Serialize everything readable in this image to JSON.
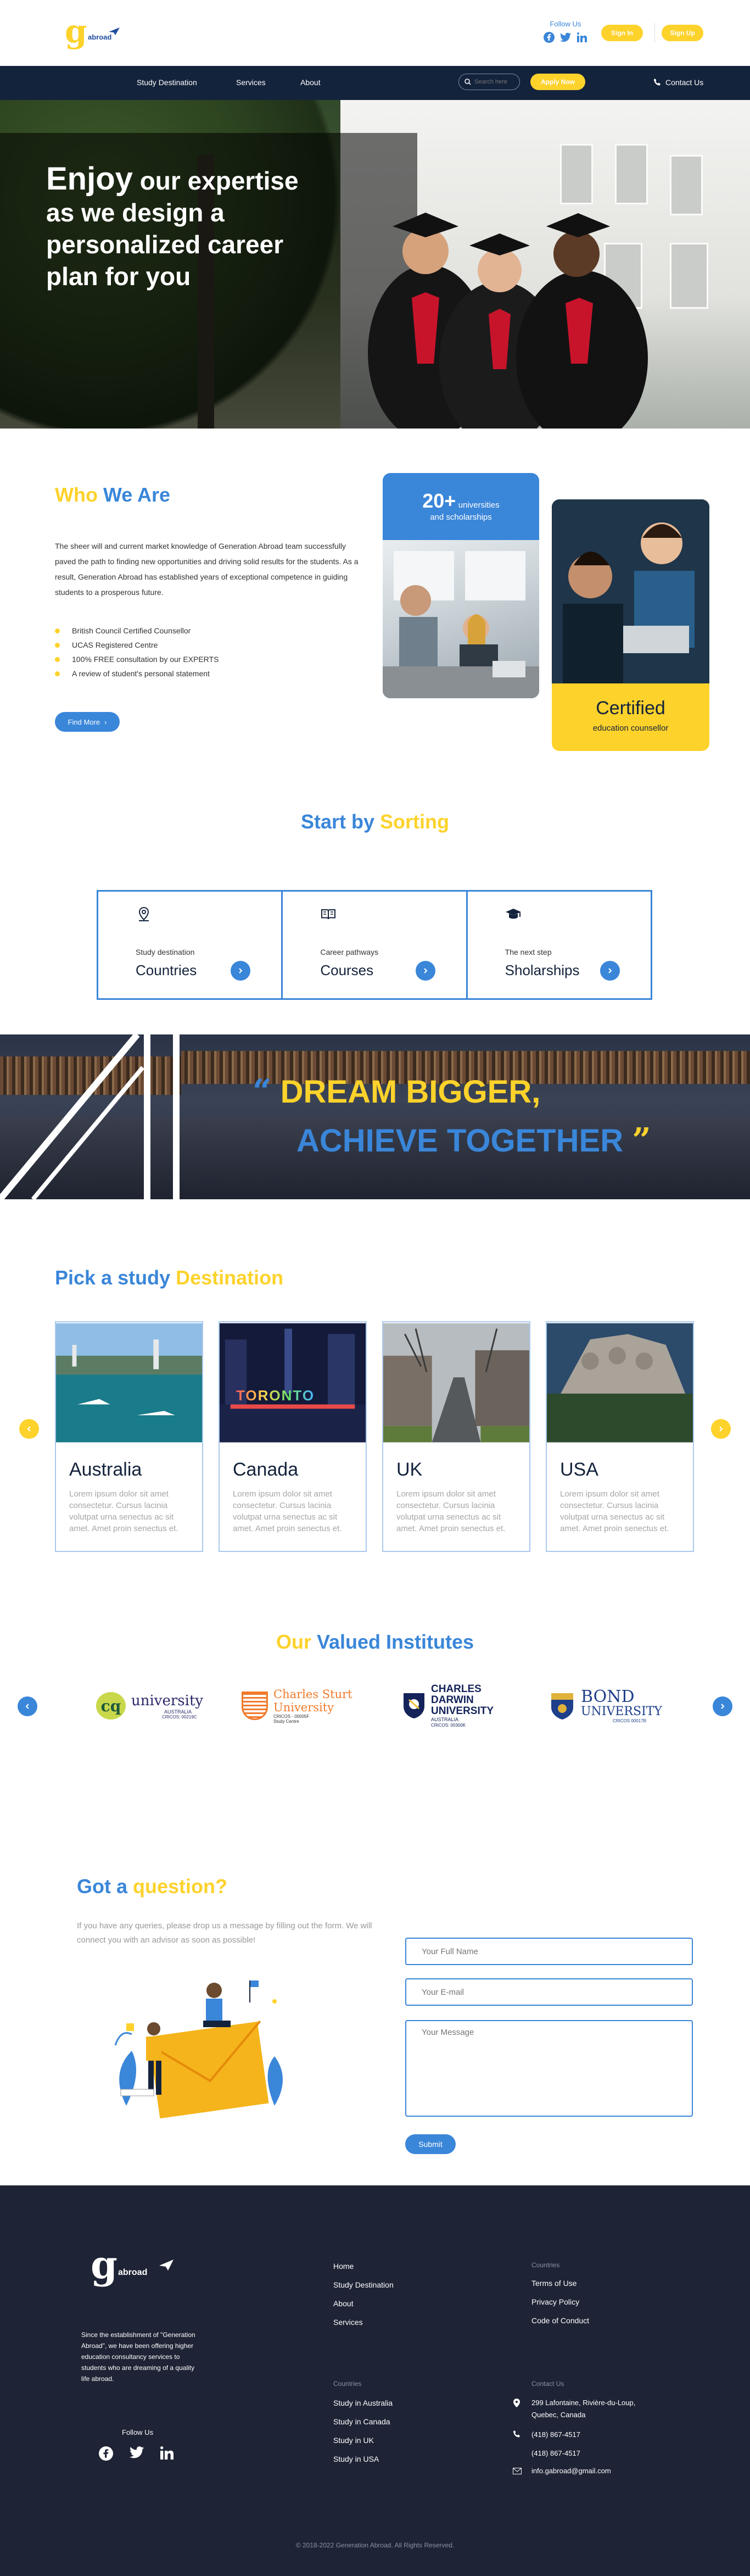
{
  "header": {
    "logo_letter": "g",
    "logo_text": "abroad",
    "follow_label": "Follow Us",
    "sign_in_label": "Sign In",
    "sign_up_label": "Sign Up"
  },
  "nav": {
    "items": [
      "Study Destination",
      "Services",
      "About"
    ],
    "search_placeholder": "Search here",
    "apply_label": "Apply Now",
    "contact_label": "Contact Us"
  },
  "hero": {
    "line1_big": "Enjoy",
    "line1_rest": " our expertise",
    "line2": "as we design a",
    "line3": "personalized career",
    "line4": "plan for you"
  },
  "who": {
    "title_a": "Who",
    "title_b": " We Are",
    "paragraph": "The sheer will and current market knowledge of Generation Abroad team successfully paved the path to finding new opportunities and driving solid results for the students. As a result, Generation Abroad has established years of exceptional competence in guiding students to a prosperous future.",
    "checks": [
      "British Council Certified Counsellor",
      "UCAS Registered Centre",
      "100% FREE consultation by our EXPERTS",
      "A review of student's personal statement"
    ],
    "button": "Find More",
    "stat_number": "20+",
    "stat_label_1": "universities",
    "stat_label_2": "and scholarships",
    "cert_title": "Certified",
    "cert_sub": "education counsellor"
  },
  "sorting": {
    "title_a": "Start by",
    "title_b": " Sorting",
    "items": [
      {
        "label": "Study destination",
        "value": "Countries",
        "icon": "map-pin-icon"
      },
      {
        "label": "Career pathways",
        "value": "Courses",
        "icon": "book-icon"
      },
      {
        "label": "The next step",
        "value": "Sholarships",
        "icon": "graduation-cap-icon"
      }
    ]
  },
  "dream": {
    "open_quote": "“",
    "line1": "DREAM BIGGER,",
    "line2": "ACHIEVE TOGETHER",
    "close_quote": "”"
  },
  "destination": {
    "title_a": "Pick a study",
    "title_b": " Destination",
    "cards": [
      {
        "name": "Australia",
        "desc": "Lorem ipsum dolor sit amet consectetur. Cursus lacinia volutpat urna senectus ac sit amet. Amet proin senectus et."
      },
      {
        "name": "Canada",
        "desc": "Lorem ipsum dolor sit amet consectetur. Cursus lacinia volutpat urna senectus ac sit amet. Amet proin senectus et."
      },
      {
        "name": "UK",
        "desc": "Lorem ipsum dolor sit amet consectetur. Cursus lacinia volutpat urna senectus ac sit amet. Amet proin senectus et."
      },
      {
        "name": "USA",
        "desc": "Lorem ipsum dolor sit amet consectetur. Cursus lacinia volutpat urna senectus ac sit amet. Amet proin senectus et."
      }
    ],
    "toronto_sign": "TORONTO"
  },
  "institutes": {
    "title_a": "Our",
    "title_b": " Valued Institutes",
    "logos": [
      {
        "main": "cq",
        "name": "university",
        "sub1": "AUSTRALIA",
        "sub2": "CRICOS: 00219C"
      },
      {
        "main": "Charles Sturt",
        "name": "University",
        "sub1": "CRICOS - 00005F",
        "sub2": "Study Centre"
      },
      {
        "main": "CHARLES",
        "name": "DARWIN",
        "sub1": "UNIVERSITY",
        "sub2": "AUSTRALIA",
        "sub3": "CRICOS: 00300K"
      },
      {
        "main": "BOND",
        "name": "UNIVERSITY",
        "sub1": "CRICOS 00017B"
      }
    ]
  },
  "question": {
    "title_a": "Got a",
    "title_b": " question?",
    "text": "If you have any queries, please drop us a message by filling out the form. We will connect you with an advisor as soon as possible!",
    "name_placeholder": "Your Full Name",
    "email_placeholder": "Your E-mail",
    "message_placeholder": "Your Message",
    "submit": "Submit"
  },
  "footer": {
    "about": "Since the establishment of \"Generation Abroad\", we have been offering higher education consultancy services to students who are dreaming of a quality life abroad.",
    "follow": "Follow Us",
    "links": [
      "Home",
      "Study Destination",
      "About",
      "Services"
    ],
    "col2_title": "Countries",
    "col2_links": [
      "Terms of Use",
      "Privacy Policy",
      "Code of Conduct"
    ],
    "col3_title": "Countries",
    "col3_links": [
      "Study in Australia",
      "Study in Canada",
      "Study in UK",
      "Study in USA"
    ],
    "col4_title": "Contact Us",
    "address_1": "299 Lafontaine, Rivière-du-Loup,",
    "address_2": "Quebec, Canada",
    "phone_1": "(418) 867-4517",
    "phone_2": "(418) 867-4517",
    "email": "info.gabroad@gmail.com",
    "copyright": "© 2018-2022 Generation Abroad. All Rights Reserved."
  },
  "colors": {
    "blue": "#3a86d9",
    "yellow": "#fdd22b",
    "navy": "#14233c",
    "footer": "#1e2335"
  }
}
